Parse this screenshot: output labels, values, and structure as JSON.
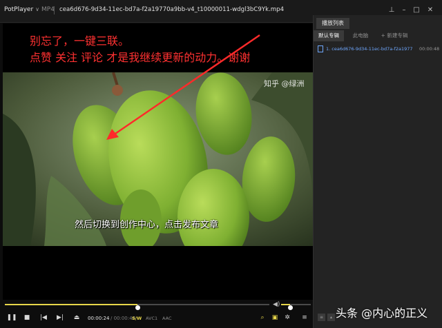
{
  "titlebar": {
    "app_name": "PotPlayer",
    "format": "MP4",
    "file_title": "cea6d676-9d34-11ec-bd7a-f2a19770a9bb-v4_t10000011-wdgl3bC9Yk.mp4"
  },
  "video": {
    "annotation_line1": "别忘了，一键三联。",
    "annotation_line2": "点赞 关注 评论 才是我继续更新的动力。谢谢",
    "watermark": "知乎 @绿洲",
    "subtitle": "然后切换到创作中心，点击发布文章",
    "annotation_color": "#ff3131"
  },
  "controls": {
    "progress": 0.5,
    "volume": 0.3,
    "time_current": "00:00:24",
    "time_total": "/ 00:00:48",
    "sw": "S/W",
    "video_codec": "AVC1",
    "audio_codec": "AAC",
    "accent_color": "#e7d64a"
  },
  "playlist": {
    "tab": "播放列表",
    "subtabs": [
      "默认专辑",
      "此电脑",
      "+ 新建专辑"
    ],
    "items": [
      {
        "name": "1. cea6d676-9d34-11ec-bd7a-f2a19770a9bb-v4_t10000011-wdgl3bC9Yk.mp4",
        "time": "00:00:48"
      }
    ]
  },
  "overlay": {
    "credit": "头条 @内心的正义"
  }
}
